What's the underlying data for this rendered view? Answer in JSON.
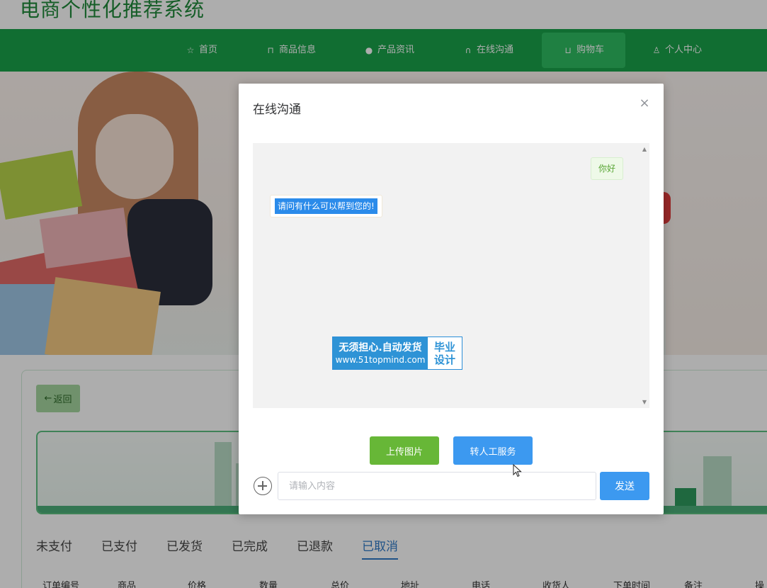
{
  "site": {
    "title": "电商个性化推荐系统"
  },
  "nav": {
    "items": [
      {
        "label": "首页",
        "icon": "star-icon"
      },
      {
        "label": "商品信息",
        "icon": "bag-icon"
      },
      {
        "label": "产品资讯",
        "icon": "info-icon"
      },
      {
        "label": "在线沟通",
        "icon": "headset-icon"
      },
      {
        "label": "购物车",
        "icon": "cart-icon",
        "active": true
      },
      {
        "label": "个人中心",
        "icon": "user-icon"
      }
    ]
  },
  "page": {
    "back_label": "返回",
    "tabs": [
      "未支付",
      "已支付",
      "已发货",
      "已完成",
      "已退款",
      "已取消"
    ],
    "active_tab": "已取消",
    "table_headers": [
      "订单编号",
      "商品",
      "价格",
      "数量",
      "总价",
      "地址",
      "电话",
      "收货人",
      "下单时间",
      "备注",
      "操"
    ]
  },
  "dialog": {
    "title": "在线沟通",
    "close_symbol": "×",
    "messages": {
      "user": "你好",
      "bot": "请问有什么可以帮到您的!"
    },
    "watermark": {
      "line1": "无须担心.自动发货",
      "line2": "www.51topmind.com",
      "right1": "毕业",
      "right2": "设计"
    },
    "upload_label": "上传图片",
    "human_label": "转人工服务",
    "input_placeholder": "请输入内容",
    "send_label": "发送"
  },
  "colors": {
    "nav_green": "#1aa34a",
    "upload_green": "#67b737",
    "primary_blue": "#3c99f0",
    "active_tab_blue": "#2e79c7"
  }
}
